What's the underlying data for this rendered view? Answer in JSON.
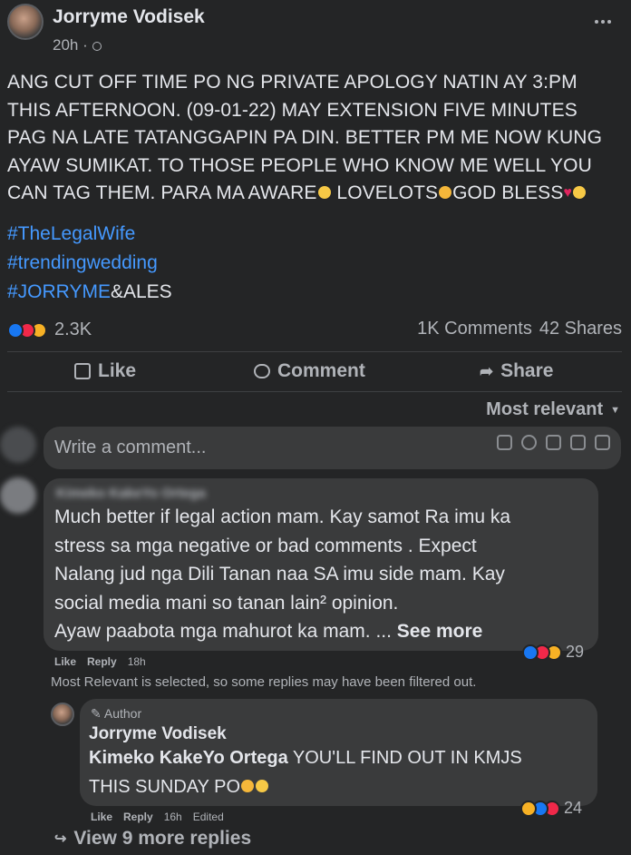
{
  "post": {
    "author": "Jorryme Vodisek",
    "time": "20h",
    "separator": "·",
    "menu_icon": "more-horizontal-icon",
    "text_lines": [
      "ANG CUT OFF TIME PO NG PRIVATE APOLOGY NATIN AY 3:PM",
      "THIS AFTERNOON. (09-01-22) MAY EXTENSION FIVE MINUTES",
      "PAG NA LATE TATANGGAPIN PA DIN. BETTER PM ME NOW KUNG",
      "AYAW SUMIKAT. TO THOSE PEOPLE WHO KNOW ME WELL YOU"
    ],
    "text_last_a": "CAN TAG THEM. PARA MA AWARE",
    "text_last_b": " LOVELOTS",
    "text_last_c": "GOD BLESS",
    "hashtags": [
      "#TheLegalWife",
      "#trendingwedding"
    ],
    "hashtag3_link": "#JORRYME",
    "hashtag3_rest": "&ALES",
    "reaction_count": "2.3K",
    "comments_count": "1K Comments",
    "shares_count": "42 Shares"
  },
  "actions": {
    "like": "Like",
    "comment": "Comment",
    "share": "Share"
  },
  "sort": {
    "label": "Most relevant"
  },
  "composer": {
    "placeholder": "Write a comment..."
  },
  "comment1": {
    "author_blurred": "Kimeko KakeYo Ortega",
    "lines": [
      "Much better if legal action mam. Kay samot Ra imu ka",
      "stress sa mga negative or bad comments . Expect",
      "Nalang jud nga Dili Tanan naa SA imu side mam. Kay",
      "social media mani so tanan lain² opinion."
    ],
    "last_line": "Ayaw paabota mga mahurot ka mam. ... ",
    "see_more": "See more",
    "like": "Like",
    "reply": "Reply",
    "time": "18h",
    "reactions": "29",
    "filter_note": "Most Relevant is selected, so some replies may have been filtered out."
  },
  "reply1": {
    "badge": "Author",
    "author": "Jorryme Vodisek",
    "mention": "Kimeko KakeYo Ortega",
    "text_a": " YOU'LL FIND OUT IN KMJS",
    "text_b": "THIS SUNDAY PO",
    "like": "Like",
    "reply": "Reply",
    "time": "16h",
    "edited": "Edited",
    "reactions": "24"
  },
  "more_replies": {
    "label": "View 9 more replies"
  }
}
